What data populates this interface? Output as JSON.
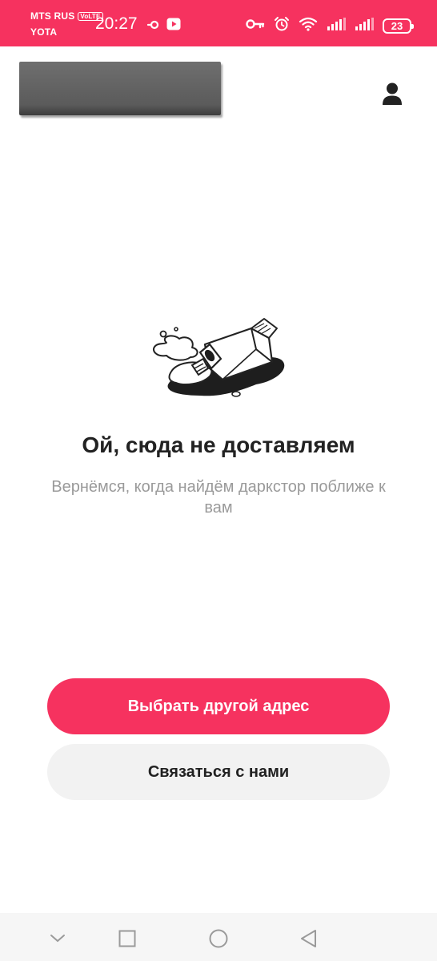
{
  "status_bar": {
    "carrier_1": "MTS RUS",
    "volte_badge": "VoLTE",
    "carrier_2": "YOTA",
    "time": "20:27",
    "battery_level": "23",
    "icons_left": [
      "sync-icon",
      "youtube-icon"
    ],
    "icons_right": [
      "key-icon",
      "alarm-icon",
      "wifi-icon",
      "signal-icon",
      "signal-icon",
      "battery-icon"
    ]
  },
  "header": {
    "profile_icon": "user-icon"
  },
  "empty_state": {
    "illustration": "spilled-milk-carton",
    "title": "Ой, сюда не доставляем",
    "subtitle": "Вернёмся, когда найдём даркстор поближе к вам"
  },
  "actions": {
    "primary_label": "Выбрать другой адрес",
    "secondary_label": "Связаться с нами"
  },
  "nav_bar": {
    "icons": [
      "chevron-down-icon",
      "square-icon",
      "circle-icon",
      "back-triangle-icon"
    ]
  },
  "colors": {
    "accent": "#f6325f",
    "title": "#222222",
    "subtitle": "#9a9a9a",
    "secondary_button": "#f2f2f2"
  }
}
